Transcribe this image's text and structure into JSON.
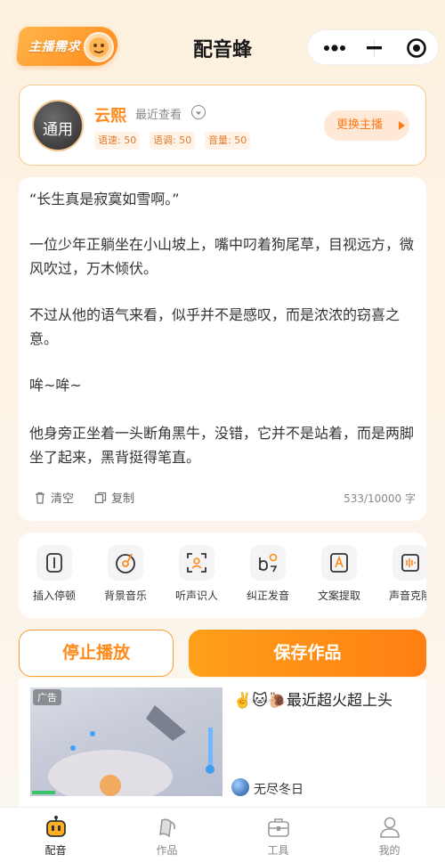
{
  "header": {
    "badge_label": "主播需求",
    "title": "配音蜂",
    "capsule": {
      "more_icon": "more-dots-icon",
      "minimize_icon": "minimize-icon",
      "close_icon": "close-circle-icon"
    }
  },
  "anchor": {
    "avatar_label": "通用",
    "name": "云熙",
    "recent_label": "最近查看",
    "params": [
      {
        "label": "语速: 50"
      },
      {
        "label": "语调: 50"
      },
      {
        "label": "音量: 50"
      }
    ],
    "change_button": "更换主播"
  },
  "editor": {
    "paragraphs": [
      "“长生真是寂寞如雪啊。”",
      "一位少年正躺坐在小山坡上，嘴中叼着狗尾草，目视远方，微风吹过，万木倾伏。",
      "不过从他的语气来看，似乎并不是感叹，而是浓浓的窃喜之意。",
      "哞~哞~",
      "他身旁正坐着一头断角黑牛，没错，它并不是站着，而是两脚坐了起来，黑背挺得笔直。"
    ],
    "clear_label": "清空",
    "copy_label": "复制",
    "counter": "533/10000 字"
  },
  "features": [
    {
      "label": "插入停顿",
      "icon": "pause-insert-icon"
    },
    {
      "label": "背景音乐",
      "icon": "music-disc-icon"
    },
    {
      "label": "听声识人",
      "icon": "voice-scan-icon"
    },
    {
      "label": "纠正发音",
      "icon": "pronunciation-icon"
    },
    {
      "label": "文案提取",
      "icon": "text-extract-icon"
    },
    {
      "label": "声音克隆",
      "icon": "voice-clone-icon"
    }
  ],
  "actions": {
    "stop_label": "停止播放",
    "save_label": "保存作品"
  },
  "ad": {
    "tag": "广告",
    "title": "✌️🐱🐌最近超火超上头",
    "source": "无尽冬日"
  },
  "tabbar": [
    {
      "label": "配音",
      "icon": "robot-icon",
      "active": true
    },
    {
      "label": "作品",
      "icon": "works-icon",
      "active": false
    },
    {
      "label": "工具",
      "icon": "toolbox-icon",
      "active": false
    },
    {
      "label": "我的",
      "icon": "profile-icon",
      "active": false
    }
  ],
  "colors": {
    "accent": "#ff8a1c",
    "accent_light": "#ffe9d6",
    "border": "#f6c98a"
  }
}
